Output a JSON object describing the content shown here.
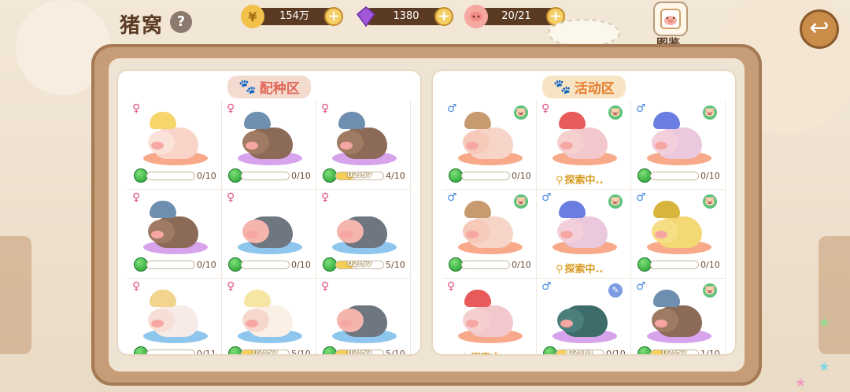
{
  "header": {
    "title": "猪窝",
    "help_label": "?",
    "gold": "154万",
    "gems": "1380",
    "pigs": "20/21",
    "plus": "+",
    "atlas_label": "图鉴",
    "back_label": "↩"
  },
  "colors": {
    "pink_shadow": "#f7a98a",
    "purple_shadow": "#d7a3ec",
    "blue_shadow": "#8fc6ee",
    "gold": "#f5cf57"
  },
  "breeding": {
    "title": "配种区",
    "pigs": [
      {
        "gender": "♀",
        "kind": "princess",
        "shadow": "pink",
        "count": "0/10",
        "fill": 0,
        "timer": ""
      },
      {
        "gender": "♀",
        "kind": "tribal",
        "shadow": "purple",
        "count": "0/10",
        "fill": 0,
        "timer": ""
      },
      {
        "gender": "♀",
        "kind": "tribal",
        "shadow": "purple",
        "count": "4/10",
        "fill": 0.35,
        "timer": "02:57"
      },
      {
        "gender": "♀",
        "kind": "tribal",
        "shadow": "purple",
        "count": "0/10",
        "fill": 0,
        "timer": ""
      },
      {
        "gender": "♀",
        "kind": "suit",
        "shadow": "blue",
        "count": "0/10",
        "fill": 0,
        "timer": ""
      },
      {
        "gender": "♀",
        "kind": "suit",
        "shadow": "blue",
        "count": "5/10",
        "fill": 0.35,
        "timer": "02:57"
      },
      {
        "gender": "♀",
        "kind": "bride",
        "shadow": "blue",
        "count": "0/11",
        "fill": 0,
        "timer": ""
      },
      {
        "gender": "♀",
        "kind": "bow",
        "shadow": "blue",
        "count": "5/10",
        "fill": 0.35,
        "timer": "02:57"
      },
      {
        "gender": "♀",
        "kind": "suit",
        "shadow": "blue",
        "count": "5/10",
        "fill": 0.35,
        "timer": "02:57"
      }
    ]
  },
  "activity": {
    "title": "活动区",
    "pigs": [
      {
        "gender": "♂",
        "kind": "hair",
        "shadow": "pink",
        "status": "green",
        "count": "0/10",
        "fill": 0,
        "timer": "",
        "explore": ""
      },
      {
        "gender": "♀",
        "kind": "flower-red",
        "shadow": "pink",
        "status": "green",
        "count": "",
        "fill": 0,
        "timer": "",
        "explore": "探索中.."
      },
      {
        "gender": "♂",
        "kind": "flower-blue",
        "shadow": "pink",
        "status": "green",
        "count": "0/10",
        "fill": 0,
        "timer": "",
        "explore": ""
      },
      {
        "gender": "♂",
        "kind": "hair",
        "shadow": "pink",
        "status": "green",
        "count": "0/10",
        "fill": 0,
        "timer": "",
        "explore": ""
      },
      {
        "gender": "♂",
        "kind": "flower-blue",
        "shadow": "pink",
        "status": "green",
        "count": "",
        "fill": 0,
        "timer": "",
        "explore": "探索中.."
      },
      {
        "gender": "♂",
        "kind": "yellow",
        "shadow": "pink",
        "status": "green",
        "count": "0/10",
        "fill": 0,
        "timer": "",
        "explore": ""
      },
      {
        "gender": "♀",
        "kind": "flower-red",
        "shadow": "pink",
        "status": "",
        "count": "",
        "fill": 0,
        "timer": "",
        "explore": "探索中"
      },
      {
        "gender": "♂",
        "kind": "spotted",
        "shadow": "purple",
        "status": "blue",
        "count": "0/10",
        "fill": 0.2,
        "timer": "02:13",
        "explore": ""
      },
      {
        "gender": "♂",
        "kind": "tribal",
        "shadow": "purple",
        "status": "green",
        "count": "1/10",
        "fill": 0.35,
        "timer": "02:57",
        "explore": ""
      }
    ]
  }
}
